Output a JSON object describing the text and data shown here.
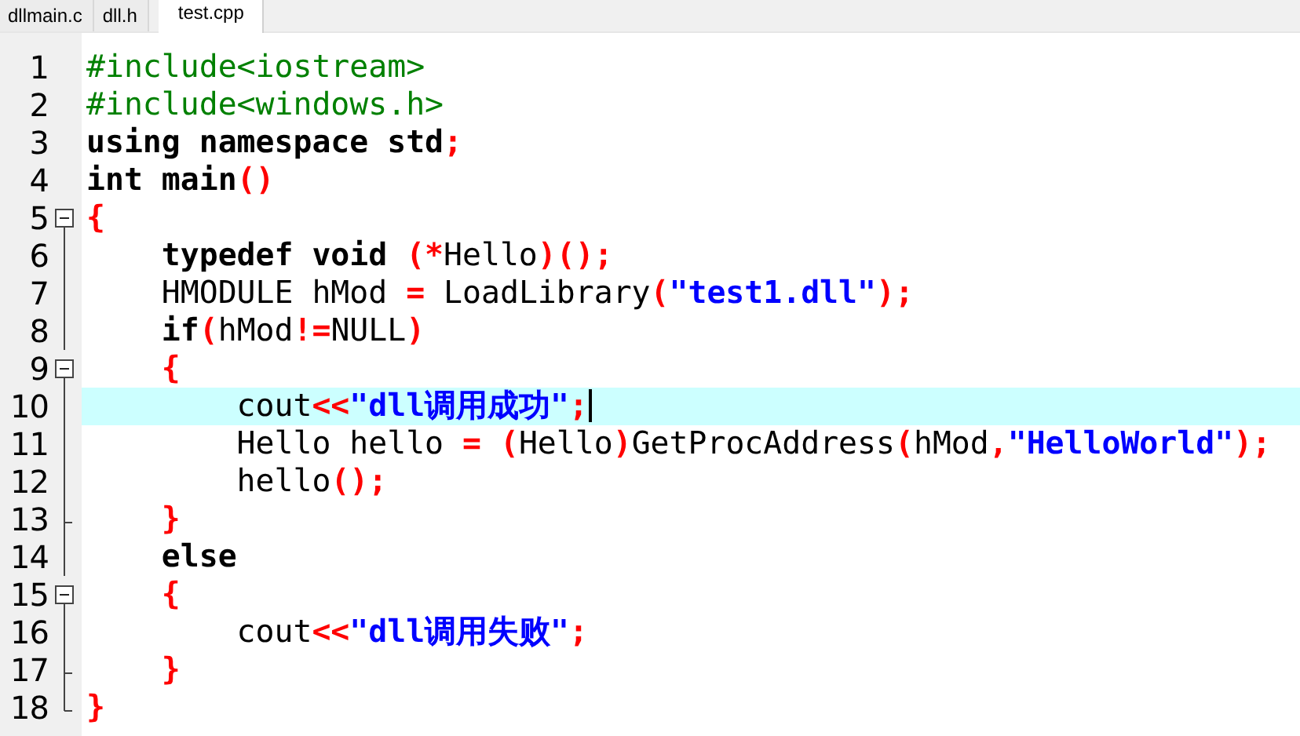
{
  "tabs": [
    {
      "label": "dllmain.c",
      "selected": false
    },
    {
      "label": "dll.h",
      "selected": false
    },
    {
      "label": "test.cpp",
      "selected": true
    }
  ],
  "editor": {
    "lines": [
      {
        "number": "1",
        "kind": "plain",
        "current": false,
        "tokens": [
          {
            "text": "#include<iostream>",
            "kind": "directive"
          }
        ]
      },
      {
        "number": "2",
        "kind": "plain",
        "current": false,
        "tokens": [
          {
            "text": "#include<windows.h>",
            "kind": "directive"
          }
        ]
      },
      {
        "number": "3",
        "kind": "plain",
        "current": false,
        "tokens": [
          {
            "text": "using namespace std",
            "kind": "keyword"
          },
          {
            "text": ";",
            "kind": "operator"
          }
        ]
      },
      {
        "number": "4",
        "kind": "plain",
        "current": false,
        "tokens": [
          {
            "text": "int main",
            "kind": "keyword"
          },
          {
            "text": "()",
            "kind": "operator"
          }
        ]
      },
      {
        "number": "5",
        "kind": "start",
        "current": false,
        "tokens": [
          {
            "text": "{",
            "kind": "operator"
          }
        ]
      },
      {
        "number": "6",
        "kind": "body",
        "current": false,
        "tokens": [
          {
            "text": "    typedef void ",
            "kind": "keyword"
          },
          {
            "text": "(*",
            "kind": "operator"
          },
          {
            "text": "Hello",
            "kind": "identifier"
          },
          {
            "text": ")();",
            "kind": "operator"
          }
        ]
      },
      {
        "number": "7",
        "kind": "body",
        "current": false,
        "tokens": [
          {
            "text": "    HMODULE hMod ",
            "kind": "identifier"
          },
          {
            "text": "=",
            "kind": "operator"
          },
          {
            "text": " LoadLibrary",
            "kind": "identifier"
          },
          {
            "text": "(",
            "kind": "operator"
          },
          {
            "text": "\"test1.dll\"",
            "kind": "string"
          },
          {
            "text": ");",
            "kind": "operator"
          }
        ]
      },
      {
        "number": "8",
        "kind": "body",
        "current": false,
        "tokens": [
          {
            "text": "    if",
            "kind": "keyword"
          },
          {
            "text": "(",
            "kind": "operator"
          },
          {
            "text": "hMod",
            "kind": "identifier"
          },
          {
            "text": "!=",
            "kind": "operator"
          },
          {
            "text": "NULL",
            "kind": "identifier"
          },
          {
            "text": ")",
            "kind": "operator"
          }
        ]
      },
      {
        "number": "9",
        "kind": "start",
        "current": false,
        "tokens": [
          {
            "text": "    {",
            "kind": "operator"
          }
        ]
      },
      {
        "number": "10",
        "kind": "body",
        "current": true,
        "tokens": [
          {
            "text": "        cout",
            "kind": "identifier"
          },
          {
            "text": "<<",
            "kind": "operator"
          },
          {
            "text": "\"dll调用成功\"",
            "kind": "string"
          },
          {
            "text": ";",
            "kind": "operator"
          }
        ]
      },
      {
        "number": "11",
        "kind": "body",
        "current": false,
        "tokens": [
          {
            "text": "        Hello hello ",
            "kind": "identifier"
          },
          {
            "text": "= (",
            "kind": "operator"
          },
          {
            "text": "Hello",
            "kind": "identifier"
          },
          {
            "text": ")",
            "kind": "operator"
          },
          {
            "text": "GetProcAddress",
            "kind": "identifier"
          },
          {
            "text": "(",
            "kind": "operator"
          },
          {
            "text": "hMod",
            "kind": "identifier"
          },
          {
            "text": ",",
            "kind": "operator"
          },
          {
            "text": "\"HelloWorld\"",
            "kind": "string"
          },
          {
            "text": ");",
            "kind": "operator"
          }
        ]
      },
      {
        "number": "12",
        "kind": "body",
        "current": false,
        "tokens": [
          {
            "text": "        hello",
            "kind": "identifier"
          },
          {
            "text": "();",
            "kind": "operator"
          }
        ]
      },
      {
        "number": "13",
        "kind": "end",
        "current": false,
        "tokens": [
          {
            "text": "    }",
            "kind": "operator"
          }
        ]
      },
      {
        "number": "14",
        "kind": "body",
        "current": false,
        "tokens": [
          {
            "text": "    else",
            "kind": "keyword"
          }
        ]
      },
      {
        "number": "15",
        "kind": "start",
        "current": false,
        "tokens": [
          {
            "text": "    {",
            "kind": "operator"
          }
        ]
      },
      {
        "number": "16",
        "kind": "body",
        "current": false,
        "tokens": [
          {
            "text": "        cout",
            "kind": "identifier"
          },
          {
            "text": "<<",
            "kind": "operator"
          },
          {
            "text": "\"dll调用失败\"",
            "kind": "string"
          },
          {
            "text": ";",
            "kind": "operator"
          }
        ]
      },
      {
        "number": "17",
        "kind": "end",
        "current": false,
        "tokens": [
          {
            "text": "    }",
            "kind": "operator"
          }
        ]
      },
      {
        "number": "18",
        "kind": "last",
        "current": false,
        "tokens": [
          {
            "text": "}",
            "kind": "operator"
          }
        ]
      }
    ]
  }
}
